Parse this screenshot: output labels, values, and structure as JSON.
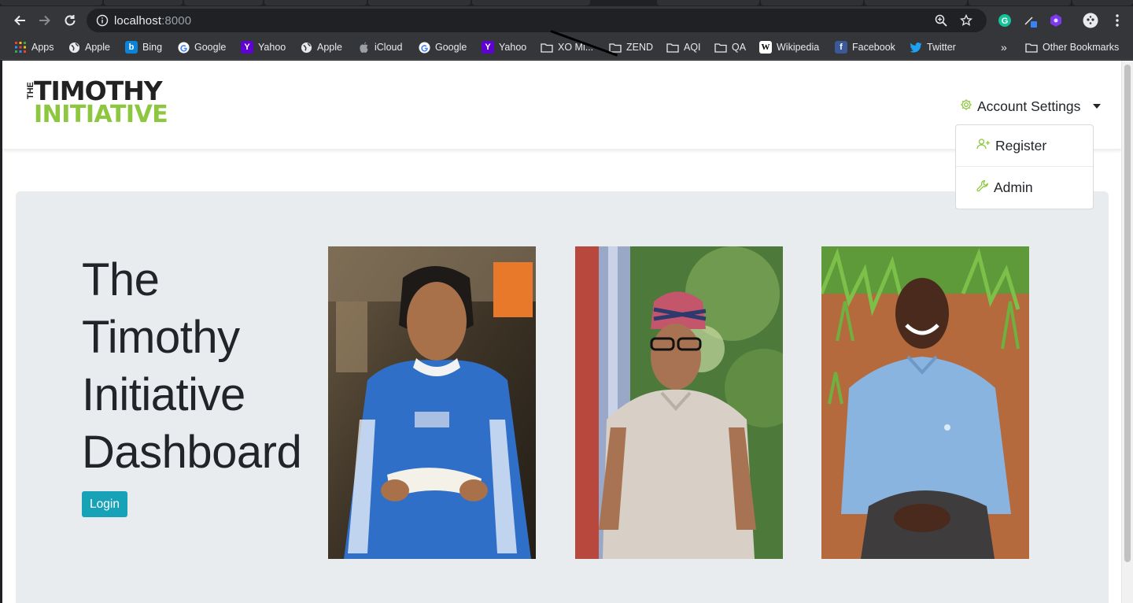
{
  "browser": {
    "url_host": "localhost",
    "url_port": ":8000",
    "bookmarks": [
      {
        "label": "Apps",
        "icon": "apps-grid-icon"
      },
      {
        "label": "Apple",
        "icon": "globe-icon"
      },
      {
        "label": "Bing",
        "icon": "bing-icon"
      },
      {
        "label": "Google",
        "icon": "google-icon"
      },
      {
        "label": "Yahoo",
        "icon": "yahoo-icon"
      },
      {
        "label": "Apple",
        "icon": "globe-icon"
      },
      {
        "label": "iCloud",
        "icon": "apple-icon"
      },
      {
        "label": "Google",
        "icon": "google-icon"
      },
      {
        "label": "Yahoo",
        "icon": "yahoo-icon"
      },
      {
        "label": "XO Mi...",
        "icon": "folder-icon"
      },
      {
        "label": "ZEND",
        "icon": "folder-icon"
      },
      {
        "label": "AQI",
        "icon": "folder-icon"
      },
      {
        "label": "QA",
        "icon": "folder-icon"
      },
      {
        "label": "Wikipedia",
        "icon": "wikipedia-icon"
      },
      {
        "label": "Facebook",
        "icon": "facebook-icon"
      },
      {
        "label": "Twitter",
        "icon": "twitter-icon"
      }
    ],
    "overflow_label": "»",
    "other_bookmarks": "Other Bookmarks"
  },
  "navbar": {
    "logo_the": "THE",
    "logo_line1": "TIMOTHY",
    "logo_line2": "INITIATIVE",
    "account_settings": "Account Settings",
    "dropdown": {
      "register": "Register",
      "admin": "Admin"
    }
  },
  "hero": {
    "title_lines": [
      "The",
      "Timothy",
      "Initiative",
      "Dashboard"
    ],
    "login_label": "Login"
  },
  "colors": {
    "brand_green": "#8dc63f",
    "login_teal": "#17a2b8",
    "jumbotron_bg": "#e9ecef"
  }
}
